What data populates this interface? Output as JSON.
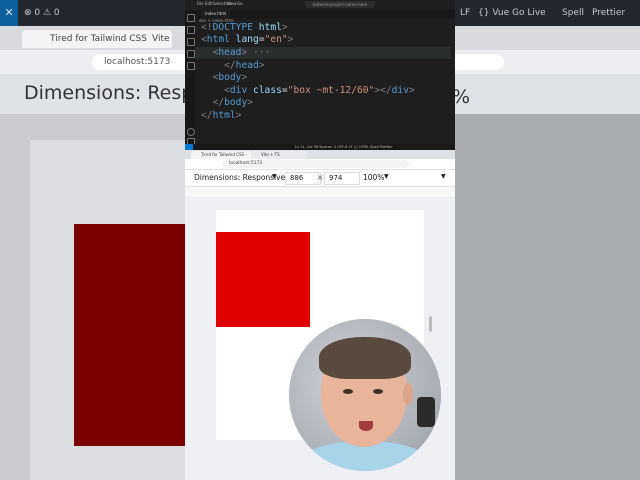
{
  "bg_browser": {
    "topbar": {
      "logo": "✕",
      "warnings": "⊗ 0 ⚠ 0",
      "status_right": [
        "LF",
        "{} Vue",
        "Go Live",
        "Spell",
        "Prettier"
      ]
    },
    "tabs": [
      "Tired for Tailwind CSS - Build ...",
      "Vite"
    ],
    "url": "localhost:5173",
    "dimensions_label": "Dimensions: Responsive",
    "zoom_partial": "%"
  },
  "vscode": {
    "menu": [
      "File",
      "Edit",
      "Selection",
      "View",
      "Go"
    ],
    "command_center": "tailwind-project-name-here",
    "tab": "index.html",
    "breadcrumb": "dev > index.html",
    "code_lines": [
      {
        "kind": "doctype",
        "text": "<!DOCTYPE html>"
      },
      {
        "kind": "html-open",
        "text": "<html lang=\"en\">"
      },
      {
        "kind": "head-fold",
        "text": "  <head> ···"
      },
      {
        "kind": "head-close",
        "text": "  </head>"
      },
      {
        "kind": "body-open",
        "text": "  <body>"
      },
      {
        "kind": "div",
        "text": "    <div class=\"box ~mt-12/60\"></div>"
      },
      {
        "kind": "body-close",
        "text": "  </body>"
      },
      {
        "kind": "html-close",
        "text": "</html>"
      }
    ],
    "status": "Ln 11, Col 38   Spaces: 2   UTF-8   LF   {} HTML   Spell   Prettier"
  },
  "browser": {
    "tabs": [
      "Tired for Tailwind CSS - Build ...",
      "Vite + TS"
    ],
    "url": "localhost:5173",
    "dimensions_label": "Dimensions: Responsive",
    "width": "886",
    "height": "974",
    "times": "×",
    "zoom": "100%"
  },
  "colors": {
    "red_box": "#e00000",
    "vscode_bg": "#1e1e1e"
  }
}
